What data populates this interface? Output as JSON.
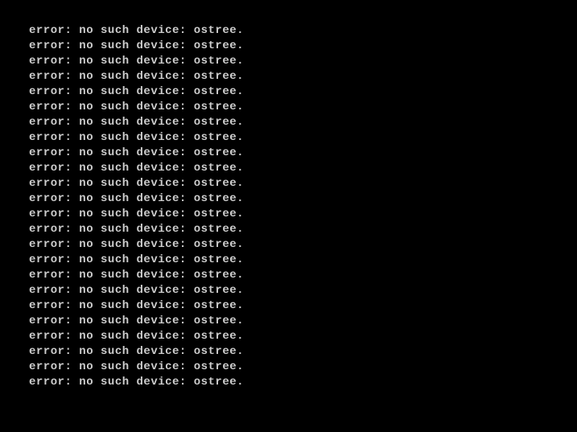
{
  "terminal": {
    "lines": [
      "error: no such device: ostree.",
      "error: no such device: ostree.",
      "error: no such device: ostree.",
      "error: no such device: ostree.",
      "error: no such device: ostree.",
      "error: no such device: ostree.",
      "error: no such device: ostree.",
      "error: no such device: ostree.",
      "error: no such device: ostree.",
      "error: no such device: ostree.",
      "error: no such device: ostree.",
      "error: no such device: ostree.",
      "error: no such device: ostree.",
      "error: no such device: ostree.",
      "error: no such device: ostree.",
      "error: no such device: ostree.",
      "error: no such device: ostree.",
      "error: no such device: ostree.",
      "error: no such device: ostree.",
      "error: no such device: ostree.",
      "error: no such device: ostree.",
      "error: no such device: ostree.",
      "error: no such device: ostree.",
      "error: no such device: ostree."
    ]
  }
}
